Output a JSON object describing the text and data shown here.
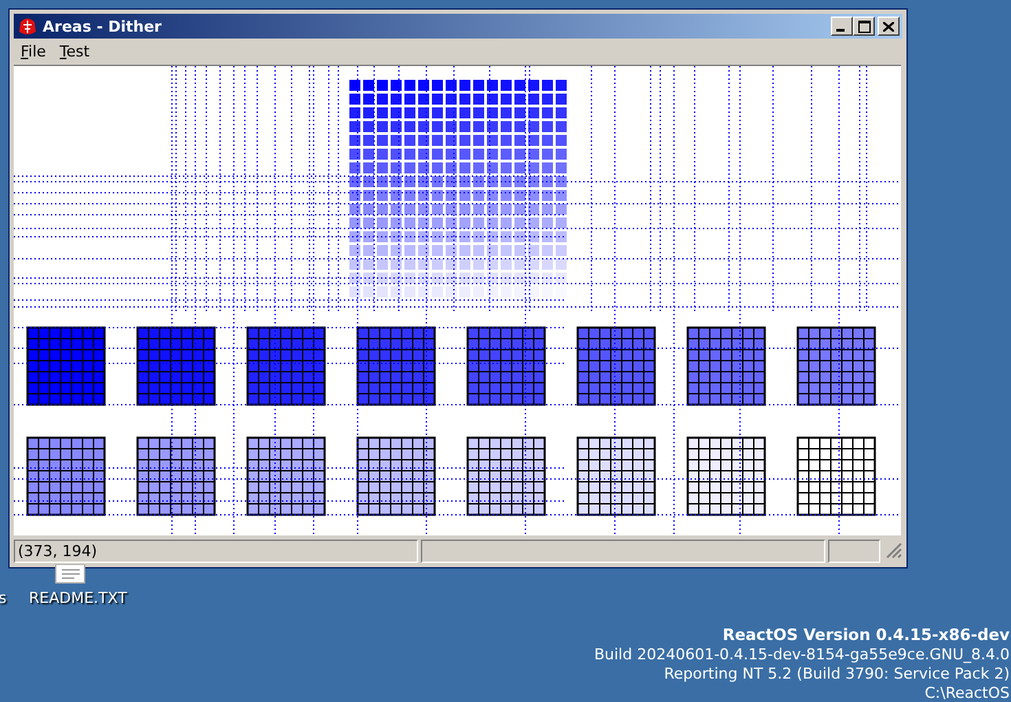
{
  "desktop": {
    "icons": [
      {
        "label": "s"
      },
      {
        "label": "README.TXT"
      }
    ]
  },
  "window": {
    "title": "Areas - Dither",
    "active": true
  },
  "menu": [
    {
      "label": "File"
    },
    {
      "label": "Test"
    }
  ],
  "status_bar": {
    "text": "(373, 194)"
  },
  "version_info": [
    "ReactOS Version 0.4.15-x86-dev",
    "Build 20240601-0.4.15-dev-8154-ga55e9ce.GNU_8.4.0",
    "Reporting NT 5.2 (Build 3790: Service Pack 2)",
    "C:\\ReactOS"
  ]
}
